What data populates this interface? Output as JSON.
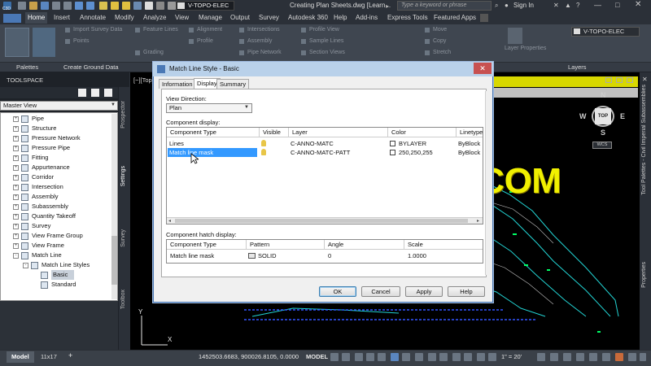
{
  "titlebar": {
    "app_badge": "C3D",
    "workspace": "V-TOPO-ELEC",
    "doc_title": "Creating Plan Sheets.dwg [Learn...",
    "search_placeholder": "Type a keyword or phrase",
    "sign_in": "Sign In"
  },
  "ribbon": {
    "tabs": [
      "Home",
      "Insert",
      "Annotate",
      "Modify",
      "Analyze",
      "View",
      "Manage",
      "Output",
      "Survey",
      "Autodesk 360",
      "Help",
      "Add-ins",
      "Express Tools",
      "Featured Apps"
    ],
    "active_tab": "Home",
    "items": {
      "import_survey_data": "Import Survey Data",
      "points": "Points",
      "feature_lines": "Feature Lines",
      "grading": "Grading",
      "alignment": "Alignment",
      "profile": "Profile",
      "intersections": "Intersections",
      "assembly": "Assembly",
      "pipe_network": "Pipe Network",
      "profile_view": "Profile View",
      "sample_lines": "Sample Lines",
      "section_views": "Section Views",
      "move": "Move",
      "copy": "Copy",
      "stretch": "Stretch",
      "layer_combo": "V-TOPO-ELEC",
      "layer_properties": "Layer Properties"
    },
    "panels": {
      "palettes": "Palettes",
      "create_ground_data": "Create Ground Data",
      "layers": "Layers"
    }
  },
  "toolspace": {
    "title": "TOOLSPACE",
    "view_select": "Master View",
    "tree": [
      {
        "label": "Pipe",
        "indent": 0,
        "expander": "+"
      },
      {
        "label": "Structure",
        "indent": 0,
        "expander": "+"
      },
      {
        "label": "Pressure Network",
        "indent": 0,
        "expander": "+"
      },
      {
        "label": "Pressure Pipe",
        "indent": 0,
        "expander": "+"
      },
      {
        "label": "Fitting",
        "indent": 0,
        "expander": "+"
      },
      {
        "label": "Appurtenance",
        "indent": 0,
        "expander": "+"
      },
      {
        "label": "Corridor",
        "indent": 0,
        "expander": "+"
      },
      {
        "label": "Intersection",
        "indent": 0,
        "expander": "+"
      },
      {
        "label": "Assembly",
        "indent": 0,
        "expander": "+"
      },
      {
        "label": "Subassembly",
        "indent": 0,
        "expander": "+"
      },
      {
        "label": "Quantity Takeoff",
        "indent": 0,
        "expander": "+"
      },
      {
        "label": "Survey",
        "indent": 0,
        "expander": "+"
      },
      {
        "label": "View Frame Group",
        "indent": 0,
        "expander": "+"
      },
      {
        "label": "View Frame",
        "indent": 0,
        "expander": "+"
      },
      {
        "label": "Match Line",
        "indent": 0,
        "expander": "-"
      },
      {
        "label": "Match Line Styles",
        "indent": 1,
        "expander": "-"
      },
      {
        "label": "Basic",
        "indent": 2,
        "expander": "",
        "selected": true
      },
      {
        "label": "Standard",
        "indent": 2,
        "expander": ""
      }
    ],
    "vertical_tabs": [
      "Prospector",
      "Settings",
      "Survey",
      "Toolbox"
    ]
  },
  "viewport": {
    "label": "[−][Top]",
    "viewcube": {
      "top": "TOP",
      "n": "N",
      "s": "S",
      "e": "E",
      "w": "W",
      "wcs": "WCS"
    }
  },
  "right_tabs": [
    "Tool Palettes - Civil Imperial Subassemblies",
    "Properties"
  ],
  "dialog": {
    "title": "Match Line Style - Basic",
    "tabs": [
      "Information",
      "Display",
      "Summary"
    ],
    "active_tab": "Display",
    "view_direction_label": "View Direction:",
    "view_direction_value": "Plan",
    "component_display_label": "Component display:",
    "component_columns": [
      "Component Type",
      "Visible",
      "Layer",
      "Color",
      "Linetype"
    ],
    "component_rows": [
      {
        "type": "Lines",
        "layer": "C-ANNO-MATC",
        "color": "BYLAYER",
        "linetype": "ByBlock",
        "selected": false
      },
      {
        "type": "Match line mask",
        "layer": "C-ANNO-MATC-PATT",
        "color": "250,250,255",
        "linetype": "ByBlock",
        "selected": true
      }
    ],
    "hatch_display_label": "Component hatch display:",
    "hatch_columns": [
      "Component Type",
      "Pattern",
      "Angle",
      "Scale"
    ],
    "hatch_rows": [
      {
        "type": "Match line mask",
        "pattern": "SOLID",
        "angle": "0",
        "scale": "1.0000"
      }
    ],
    "buttons": {
      "ok": "OK",
      "cancel": "Cancel",
      "apply": "Apply",
      "help": "Help"
    }
  },
  "watermark": "WWW.CGTSJ.COM",
  "statusbar": {
    "tabs": [
      "Model",
      "11x17"
    ],
    "active_tab": "Model",
    "coords": "1452503.6683, 900026.8105, 0.0000",
    "model": "MODEL",
    "scale": "1\" = 20'"
  },
  "colors": {
    "accent": "#3399ff",
    "watermark": "#f0f000",
    "title_active": "#b9d1ea",
    "close_button": "#c75050"
  }
}
